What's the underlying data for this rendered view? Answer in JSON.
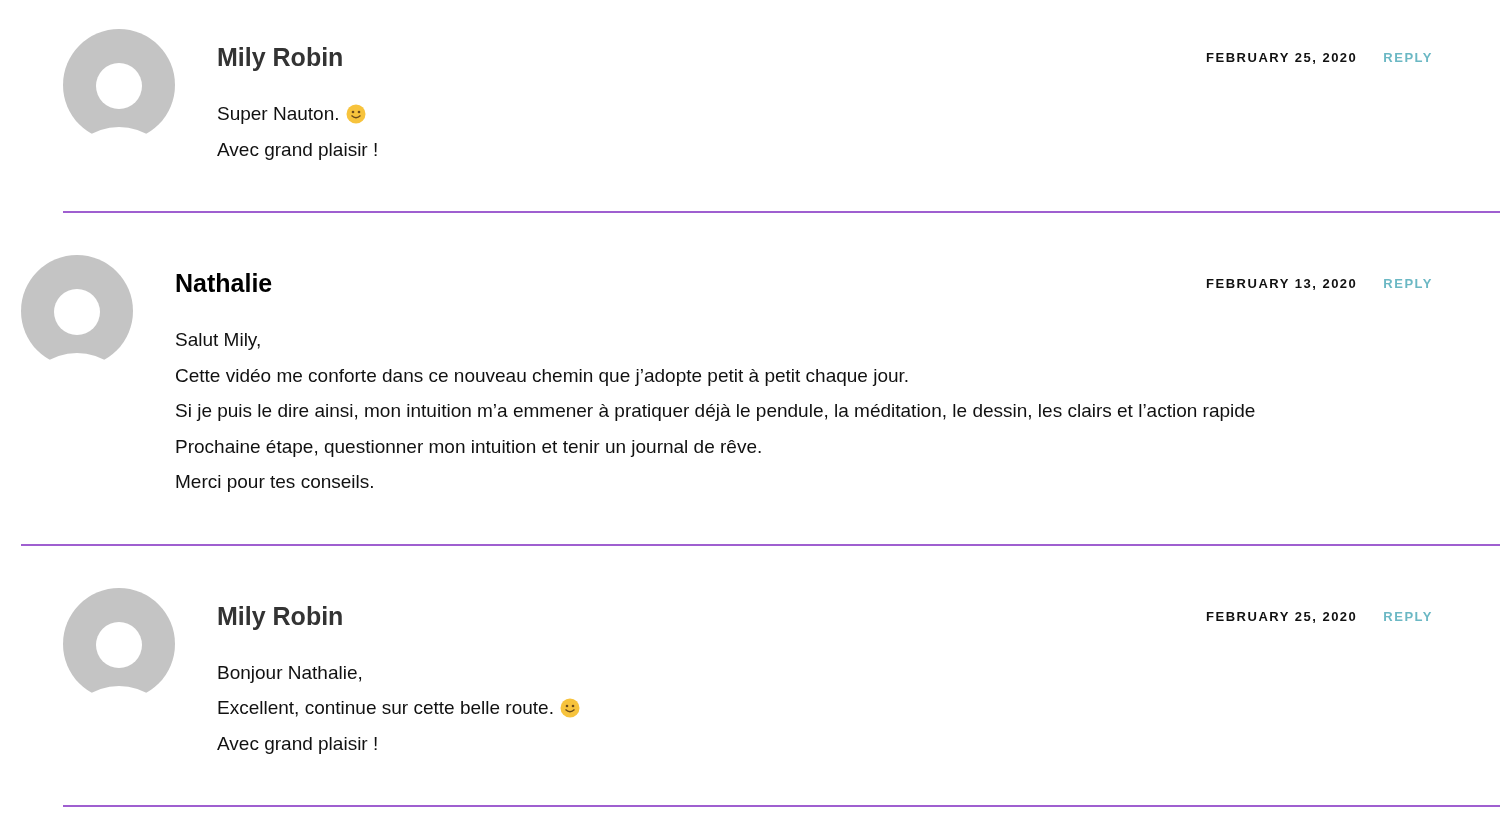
{
  "comments": [
    {
      "kind": "reply",
      "author": "Mily Robin",
      "is_author": true,
      "date": "FEBRUARY 25, 2020",
      "reply": "REPLY",
      "lines": [
        {
          "text": "Super Nauton.",
          "emoji": true
        },
        {
          "text": "Avec grand plaisir !"
        }
      ]
    },
    {
      "kind": "comment",
      "author": "Nathalie",
      "is_author": false,
      "date": "FEBRUARY 13, 2020",
      "reply": "REPLY",
      "lines": [
        {
          "text": "Salut Mily,"
        },
        {
          "text": "Cette vidéo me conforte dans ce nouveau chemin que j’adopte petit à petit chaque jour."
        },
        {
          "text": "Si je puis le dire ainsi, mon intuition m’a emmener à pratiquer déjà le pendule, la méditation, le dessin, les clairs et l’action rapide"
        },
        {
          "text": "Prochaine étape, questionner mon intuition et tenir un journal de rêve."
        },
        {
          "text": "Merci pour tes conseils."
        }
      ]
    },
    {
      "kind": "reply",
      "author": "Mily Robin",
      "is_author": true,
      "date": "FEBRUARY 25, 2020",
      "reply": "REPLY",
      "lines": [
        {
          "text": "Bonjour Nathalie,"
        },
        {
          "text": "Excellent, continue sur cette belle route.",
          "emoji": true
        },
        {
          "text": "Avec grand plaisir !"
        }
      ]
    }
  ]
}
